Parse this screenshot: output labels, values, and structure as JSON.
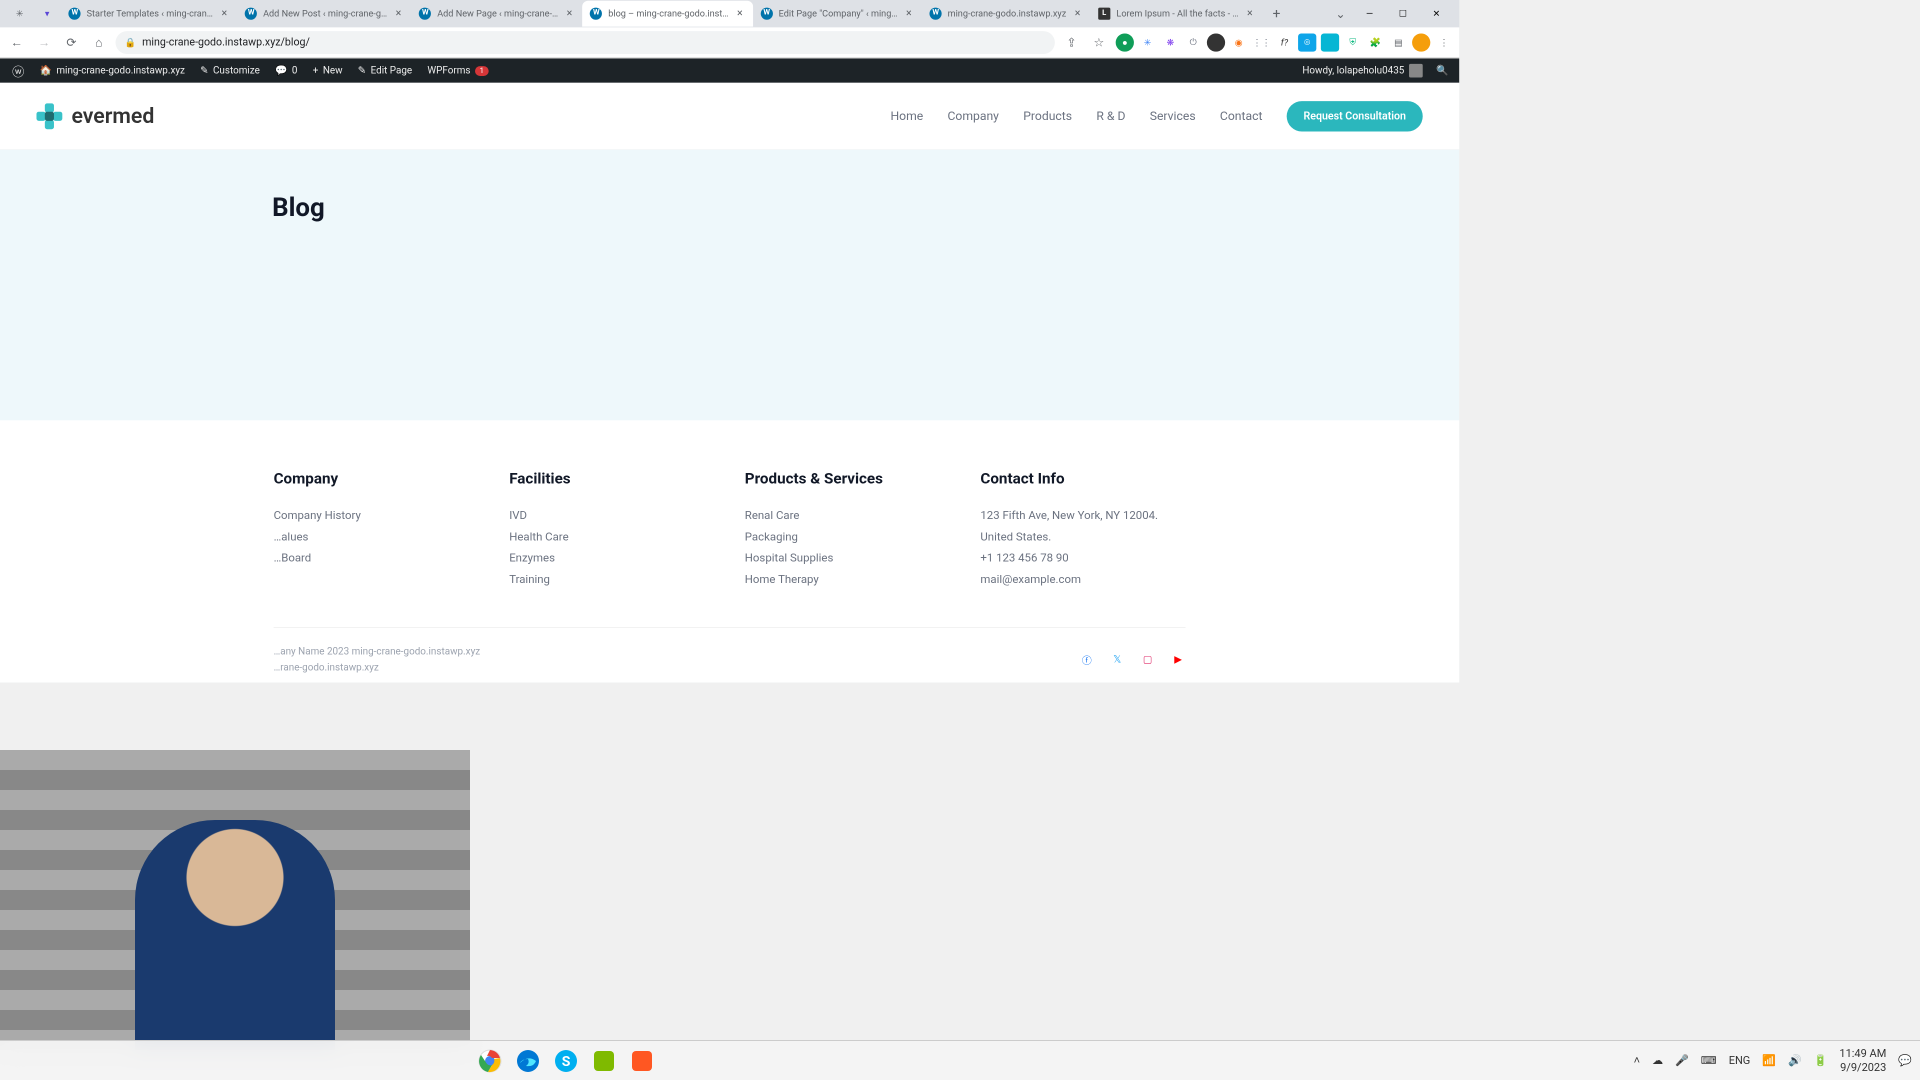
{
  "browser": {
    "tabs": [
      {
        "title": "",
        "type": "icon"
      },
      {
        "title": "",
        "type": "icon"
      },
      {
        "title": "Starter Templates ‹ ming-cran…"
      },
      {
        "title": "Add New Post ‹ ming-crane-g…"
      },
      {
        "title": "Add New Page ‹ ming-crane-…"
      },
      {
        "title": "blog – ming-crane-godo.inst…",
        "active": true
      },
      {
        "title": "Edit Page \"Company\" ‹ ming…"
      },
      {
        "title": "ming-crane-godo.instawp.xyz"
      },
      {
        "title": "Lorem Ipsum - All the facts - …"
      }
    ],
    "url": "ming-crane-godo.instawp.xyz/blog/"
  },
  "wp_bar": {
    "site": "ming-crane-godo.instawp.xyz",
    "customize": "Customize",
    "comments": "0",
    "new": "New",
    "edit": "Edit Page",
    "wpforms": "WPForms",
    "wpforms_badge": "1",
    "howdy": "Howdy, lolapeholu0435"
  },
  "site": {
    "logo_text": "evermed",
    "nav": [
      "Home",
      "Company",
      "Products",
      "R & D",
      "Services",
      "Contact"
    ],
    "cta": "Request Consultation",
    "page_title": "Blog"
  },
  "footer": {
    "cols": [
      {
        "heading": "Company",
        "links": [
          "Company History",
          "…alues",
          "…Board"
        ]
      },
      {
        "heading": "Facilities",
        "links": [
          "IVD",
          "Health Care",
          "Enzymes",
          "Training"
        ]
      },
      {
        "heading": "Products & Services",
        "links": [
          "Renal Care",
          "Packaging",
          "Hospital Supplies",
          "Home Therapy"
        ]
      },
      {
        "heading": "Contact Info",
        "links": [
          "123 Fifth Ave, New York, NY 12004.",
          "United States.",
          "+1 123 456 78 90",
          "mail@example.com"
        ]
      }
    ],
    "copyright1": "…any Name 2023 ming-crane-godo.instawp.xyz",
    "copyright2": "…rane-godo.instawp.xyz"
  },
  "taskbar": {
    "lang": "ENG",
    "time": "11:49 AM",
    "date": "9/9/2023"
  }
}
